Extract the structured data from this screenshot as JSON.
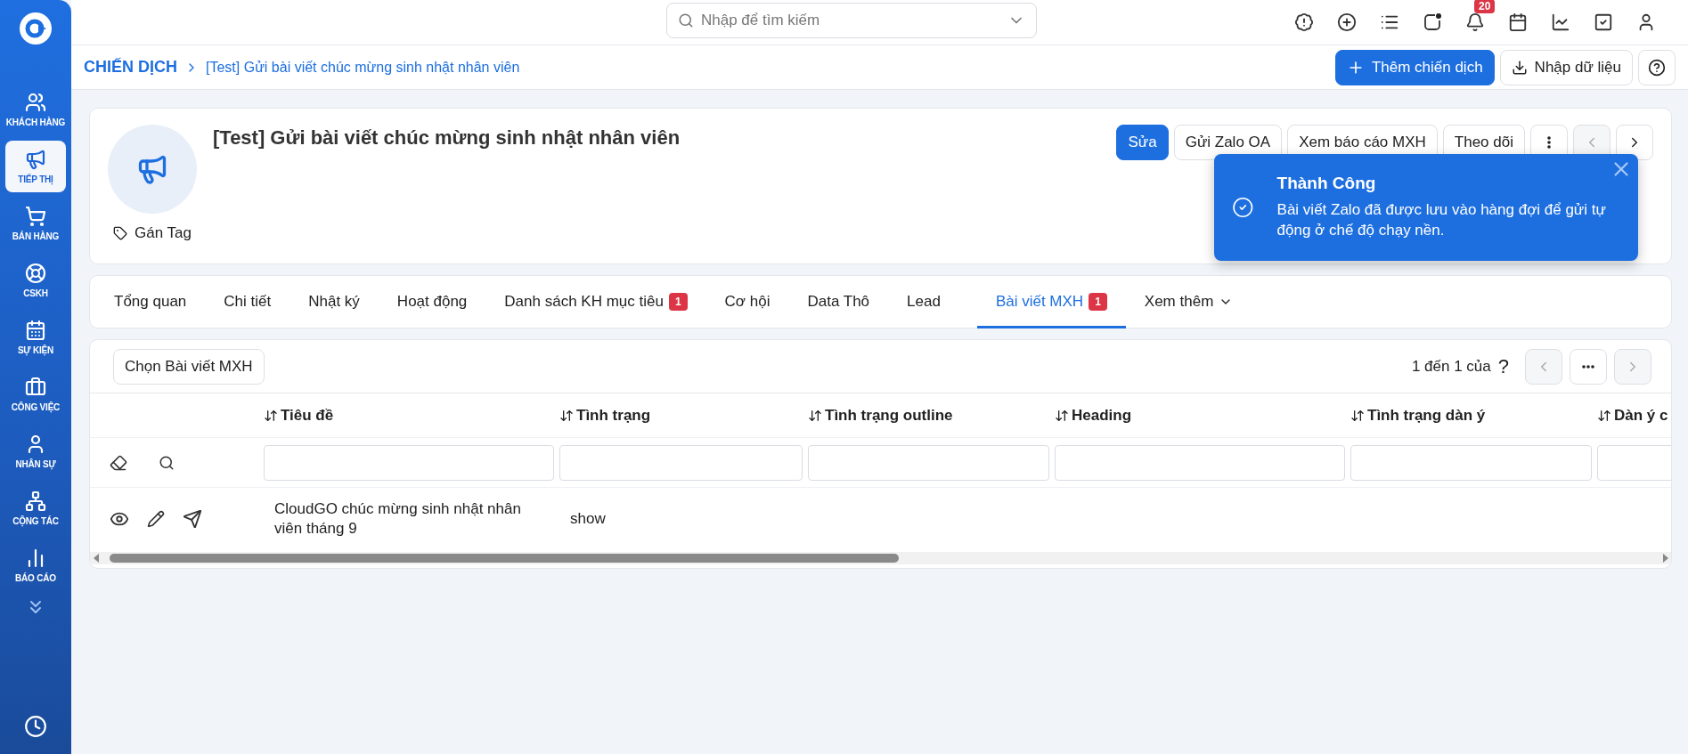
{
  "sidebar": {
    "items": [
      {
        "label": "KHÁCH HÀNG",
        "selected": false
      },
      {
        "label": "TIẾP THỊ",
        "selected": true
      },
      {
        "label": "BÁN HÀNG",
        "selected": false
      },
      {
        "label": "CSKH",
        "selected": false
      },
      {
        "label": "SỰ KIỆN",
        "selected": false
      },
      {
        "label": "CÔNG VIỆC",
        "selected": false
      },
      {
        "label": "NHÂN SỰ",
        "selected": false
      },
      {
        "label": "CỘNG TÁC",
        "selected": false
      },
      {
        "label": "BÁO CÁO",
        "selected": false
      }
    ]
  },
  "search": {
    "placeholder": "Nhập để tìm kiếm"
  },
  "notifications": {
    "badge": "20"
  },
  "breadcrumb": {
    "root": "CHIẾN DỊCH",
    "current": "[Test] Gửi bài viết chúc mừng sinh nhật nhân viên"
  },
  "page_actions": {
    "add": "Thêm chiến dịch",
    "import": "Nhập dữ liệu"
  },
  "record": {
    "title": "[Test] Gửi bài viết chúc mừng sinh nhật nhân viên",
    "tag_label": "Gán Tag",
    "actions": [
      {
        "label": "Sửa",
        "primary": true
      },
      {
        "label": "Gửi Zalo OA",
        "primary": false
      },
      {
        "label": "Xem báo cáo MXH",
        "primary": false
      },
      {
        "label": "Theo dõi",
        "primary": false
      }
    ]
  },
  "tabs": [
    {
      "label": "Tổng quan",
      "selected": false
    },
    {
      "label": "Chi tiết",
      "selected": false
    },
    {
      "label": "Nhật ký",
      "selected": false
    },
    {
      "label": "Hoạt động",
      "selected": false
    },
    {
      "label": "Danh sách KH mục tiêu",
      "badge": "1",
      "selected": false
    },
    {
      "label": "Cơ hội",
      "selected": false
    },
    {
      "label": "Data Thô",
      "selected": false
    },
    {
      "label": "Lead",
      "selected": false
    },
    {
      "label": "Bài viết MXH",
      "badge": "1",
      "selected": true
    }
  ],
  "more_tabs": "Xem thêm",
  "table": {
    "select_button": "Chọn Bài viết MXH",
    "pager": "1 đến 1 của",
    "pager_total": "?",
    "columns": [
      "Tiêu đề",
      "Tình trạng",
      "Tình trạng outline",
      "Heading",
      "Tình trạng dàn ý",
      "Dàn ý c"
    ],
    "rows": [
      {
        "title": "CloudGO chúc mừng sinh nhật nhân viên tháng 9",
        "status": "show"
      }
    ]
  },
  "toast": {
    "title": "Thành Công",
    "message": "Bài viết Zalo đã được lưu vào hàng đợi để gửi tự động ở chế độ chạy nền."
  }
}
